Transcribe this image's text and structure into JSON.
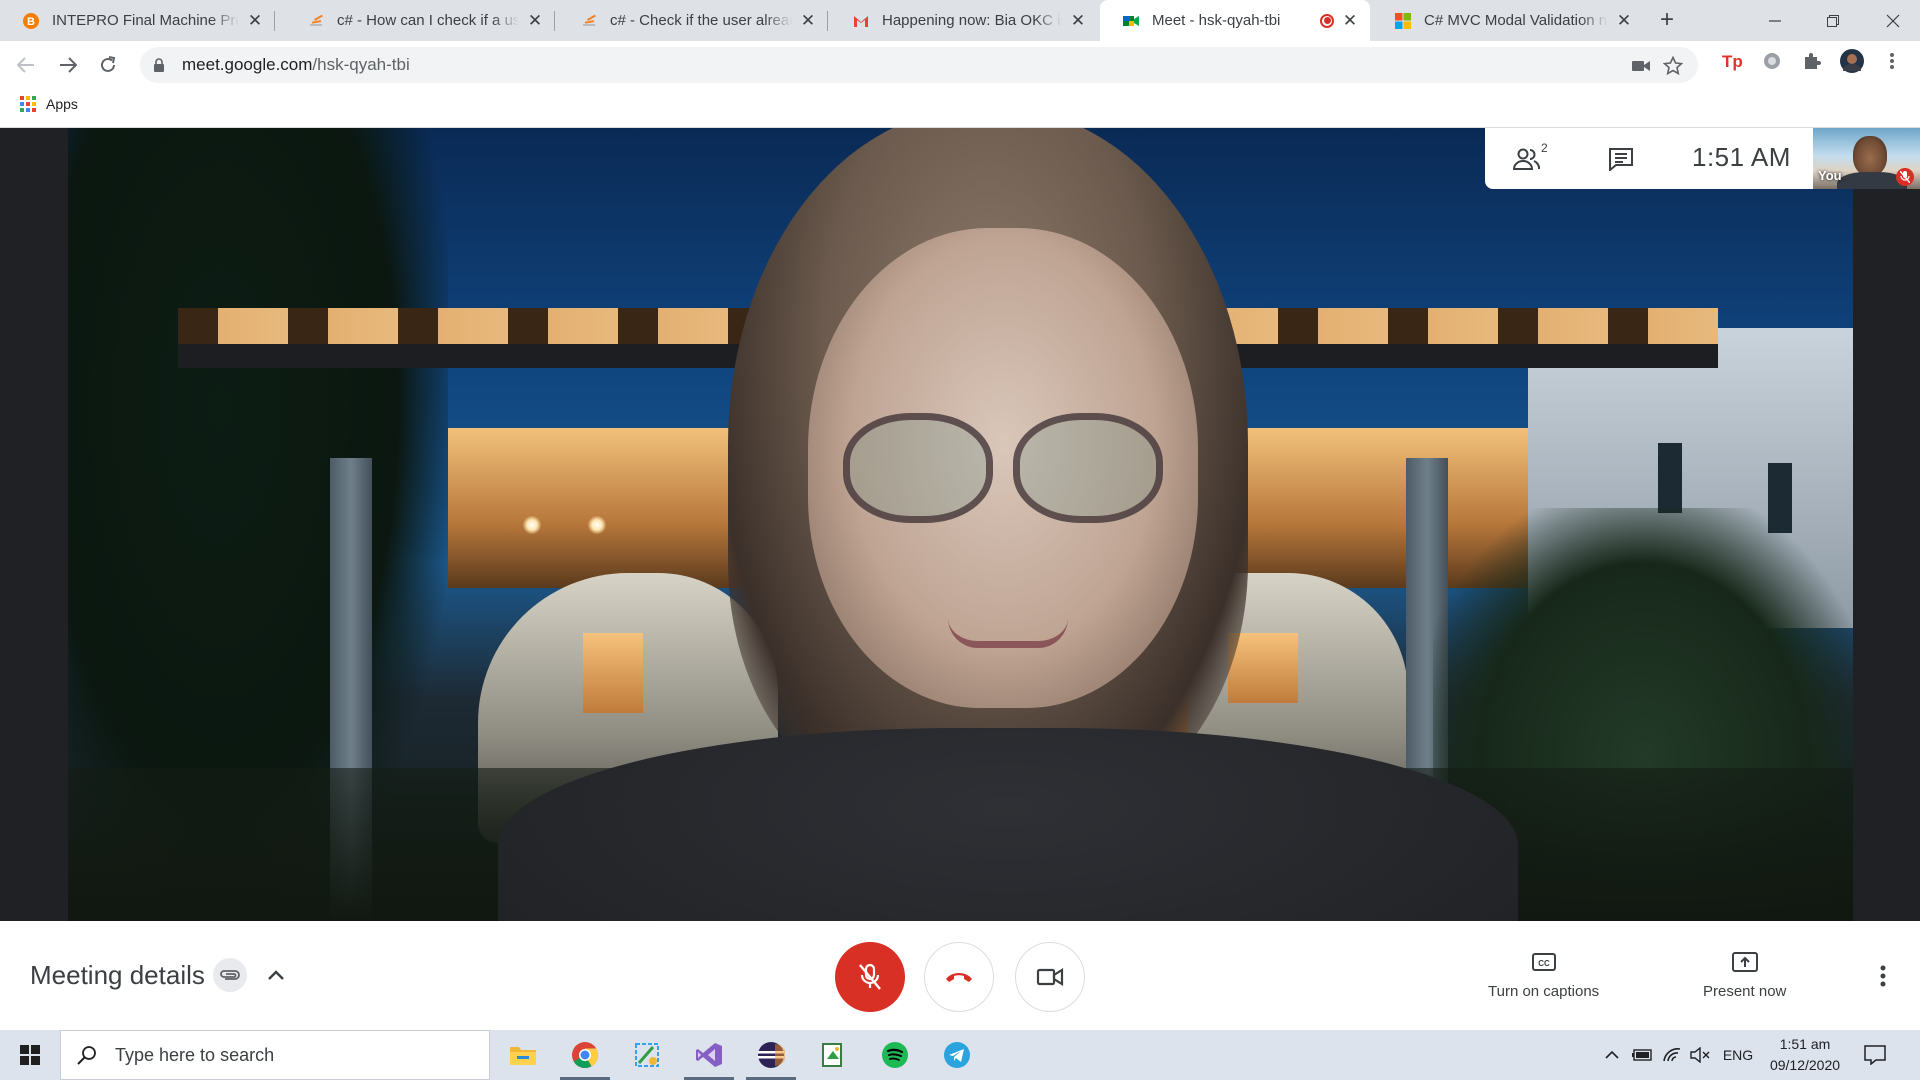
{
  "browser": {
    "tabs": [
      {
        "title": "INTEPRO Final Machine Proje",
        "favicon": "blogger-icon",
        "active": false
      },
      {
        "title": "c# - How can I check if a user",
        "favicon": "stackoverflow-icon",
        "active": false
      },
      {
        "title": "c# - Check if the user already",
        "favicon": "stackoverflow-icon",
        "active": false
      },
      {
        "title": "Happening now: Bia OKC is i",
        "favicon": "gmail-icon",
        "active": false
      },
      {
        "title": "Meet - hsk-qyah-tbi",
        "favicon": "meet-icon",
        "active": true,
        "recording": true
      },
      {
        "title": "C# MVC Modal Validation no",
        "favicon": "microsoft-icon",
        "active": false
      }
    ],
    "url_host": "meet.google.com",
    "url_path": "/hsk-qyah-tbi",
    "bookmarks": {
      "apps_label": "Apps"
    },
    "colors": {
      "tabbar": "#dee1e6",
      "accent_red": "#d93025"
    }
  },
  "meet": {
    "participants_count": "2",
    "time": "1:51  AM",
    "self_label": "You",
    "meeting_details_label": "Meeting details",
    "captions_label": "Turn on captions",
    "present_label": "Present now",
    "mic_state": "muted"
  },
  "taskbar": {
    "search_placeholder": "Type here to search",
    "apps": [
      "file-explorer-icon",
      "chrome-icon",
      "snip-icon",
      "visual-studio-icon",
      "eclipse-icon",
      "notepad-icon",
      "spotify-icon",
      "telegram-icon"
    ],
    "language": "ENG",
    "clock_time": "1:51 am",
    "clock_date": "09/12/2020"
  }
}
